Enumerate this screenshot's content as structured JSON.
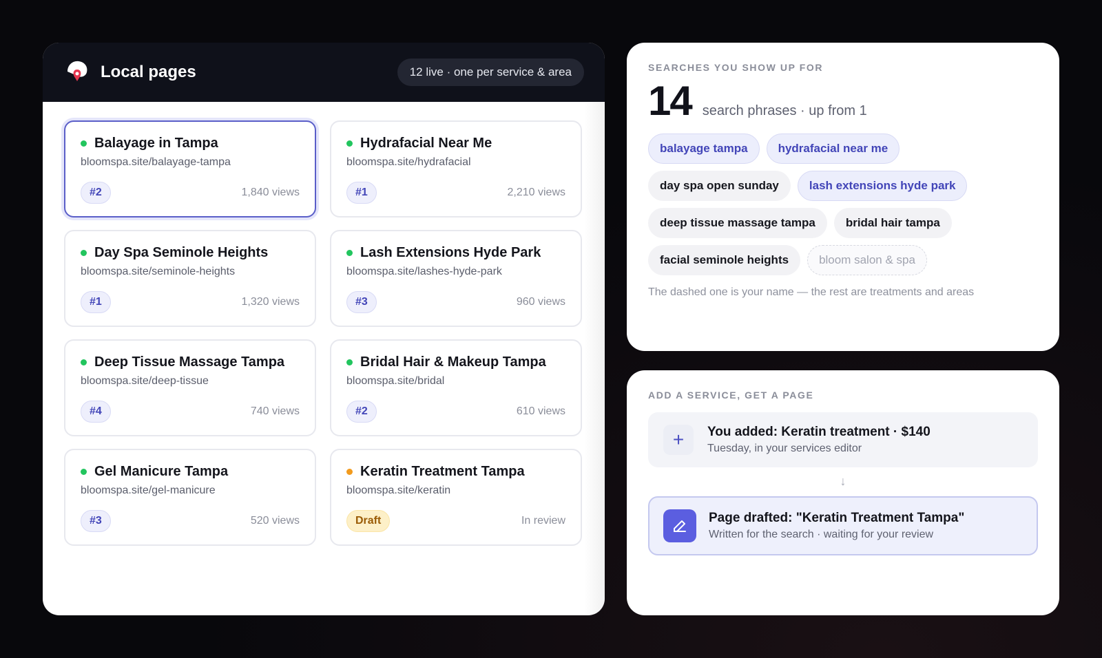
{
  "local_pages": {
    "title": "Local pages",
    "summary_pill": "12 live · one per service & area",
    "cards": [
      {
        "title": "Balayage in Tampa",
        "url": "bloomspa.site/balayage-tampa",
        "rank": "#2",
        "views": "1,840 views",
        "status": "live",
        "selected": true
      },
      {
        "title": "Hydrafacial Near Me",
        "url": "bloomspa.site/hydrafacial",
        "rank": "#1",
        "views": "2,210 views",
        "status": "live"
      },
      {
        "title": "Day Spa Seminole Heights",
        "url": "bloomspa.site/seminole-heights",
        "rank": "#1",
        "views": "1,320 views",
        "status": "live"
      },
      {
        "title": "Lash Extensions Hyde Park",
        "url": "bloomspa.site/lashes-hyde-park",
        "rank": "#3",
        "views": "960 views",
        "status": "live"
      },
      {
        "title": "Deep Tissue Massage Tampa",
        "url": "bloomspa.site/deep-tissue",
        "rank": "#4",
        "views": "740 views",
        "status": "live"
      },
      {
        "title": "Bridal Hair & Makeup Tampa",
        "url": "bloomspa.site/bridal",
        "rank": "#2",
        "views": "610 views",
        "status": "live"
      },
      {
        "title": "Gel Manicure Tampa",
        "url": "bloomspa.site/gel-manicure",
        "rank": "#3",
        "views": "520 views",
        "status": "live"
      },
      {
        "title": "Keratin Treatment Tampa",
        "url": "bloomspa.site/keratin",
        "rank": "Draft",
        "views": "In review",
        "status": "draft"
      }
    ]
  },
  "searches": {
    "eyebrow": "Searches you show up for",
    "count": "14",
    "count_label": "search phrases · up from 1",
    "chips": [
      {
        "label": "balayage tampa",
        "kind": "hl"
      },
      {
        "label": "hydrafacial near me",
        "kind": "hl"
      },
      {
        "label": "day spa open sunday",
        "kind": "plain"
      },
      {
        "label": "lash extensions hyde park",
        "kind": "hl"
      },
      {
        "label": "deep tissue massage tampa",
        "kind": "plain"
      },
      {
        "label": "bridal hair tampa",
        "kind": "plain"
      },
      {
        "label": "facial seminole heights",
        "kind": "plain"
      },
      {
        "label": "bloom salon & spa",
        "kind": "name"
      }
    ],
    "note": "The dashed one is your name — the rest are treatments and areas"
  },
  "service": {
    "eyebrow": "Add a service, get a page",
    "added_title": "You added: Keratin treatment · $140",
    "added_sub": "Tuesday, in your services editor",
    "arrow": "↓",
    "draft_title": "Page drafted: \"Keratin Treatment Tampa\"",
    "draft_sub": "Written for the search · waiting for your review"
  },
  "colors": {
    "accent": "#4245b8",
    "live_dot": "#22c55e",
    "draft_dot": "#f29b1e",
    "header_bg": "#0f111a"
  }
}
